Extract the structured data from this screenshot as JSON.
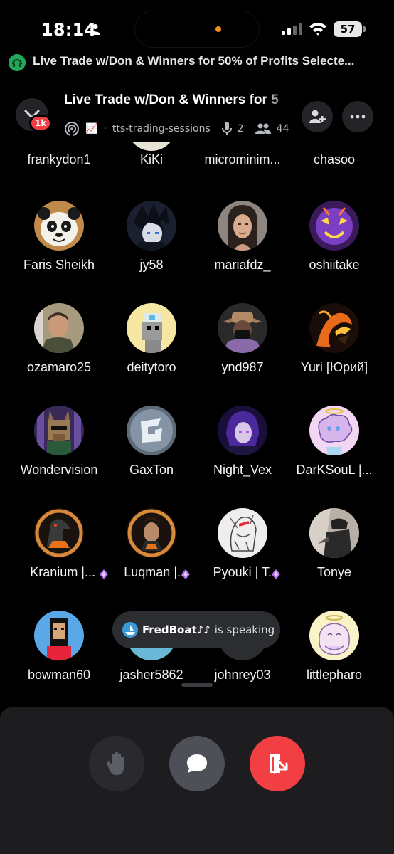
{
  "status_bar": {
    "time": "18:14",
    "battery": "57"
  },
  "banner": {
    "text": "Live Trade w/Don & Winners for 50% of Profits Selecte..."
  },
  "header": {
    "title": "Live Trade w/Don & Winners for 5",
    "badge": "1k",
    "channel_emoji": "📈",
    "channel": "tts-trading-sessions",
    "speakers": "2",
    "listeners": "44"
  },
  "participants": [
    {
      "name": "frankydon1"
    },
    {
      "name": "KiKi"
    },
    {
      "name": "microminim..."
    },
    {
      "name": "chasoo"
    },
    {
      "name": "Faris Sheikh"
    },
    {
      "name": "jy58"
    },
    {
      "name": "mariafdz_"
    },
    {
      "name": "oshiitake"
    },
    {
      "name": "ozamaro25"
    },
    {
      "name": "deitytoro"
    },
    {
      "name": "ynd987"
    },
    {
      "name": "Yuri [Юрий]"
    },
    {
      "name": "Wondervision"
    },
    {
      "name": "GaxTon"
    },
    {
      "name": "Night_Vex"
    },
    {
      "name": "DarKSouL |..."
    },
    {
      "name": "Kranium |..."
    },
    {
      "name": "Luqman |..."
    },
    {
      "name": "Pyouki | T..."
    },
    {
      "name": "Tonye"
    },
    {
      "name": "bowman60"
    },
    {
      "name": "jasher5862"
    },
    {
      "name": "johnrey03"
    },
    {
      "name": "littlepharo"
    }
  ],
  "toast": {
    "name": "FredBoat♪♪",
    "text": "is speaking"
  },
  "colors": {
    "leave": "#f23f43",
    "live": "#23a55a",
    "gem": "#b473f5",
    "badge": "#f23f43"
  },
  "icons": {
    "raise_hand": "hand-icon",
    "chat": "chat-bubble-icon",
    "leave": "leave-stage-icon",
    "invite": "add-user-icon",
    "more": "more-icon"
  }
}
